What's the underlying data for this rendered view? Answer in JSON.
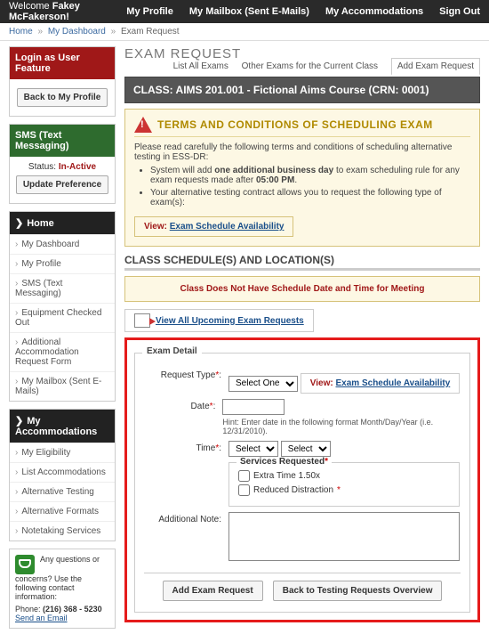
{
  "topbar": {
    "welcome_prefix": "Welcome",
    "username": "Fakey McFakerson!",
    "nav": {
      "profile": "My Profile",
      "mailbox": "My Mailbox (Sent E-Mails)",
      "accom": "My Accommodations",
      "signout": "Sign Out"
    }
  },
  "crumbs": {
    "home": "Home",
    "dash": "My Dashboard",
    "current": "Exam Request",
    "sep": "»"
  },
  "side": {
    "login": {
      "header": "Login as User Feature",
      "back_btn": "Back to My Profile"
    },
    "sms": {
      "header": "SMS (Text Messaging)",
      "status_lbl": "Status:",
      "status_val": "In-Active",
      "btn": "Update Preference"
    },
    "home": {
      "header": "Home",
      "items": [
        "My Dashboard",
        "My Profile",
        "SMS (Text Messaging)",
        "Equipment Checked Out",
        "Additional Accommodation Request Form",
        "My Mailbox (Sent E-Mails)"
      ]
    },
    "acc": {
      "header": "My Accommodations",
      "items": [
        "My Eligibility",
        "List Accommodations",
        "Alternative Testing",
        "Alternative Formats",
        "Notetaking Services"
      ]
    },
    "contact": {
      "q": "Any questions or concerns? Use the following contact information:",
      "phone_lbl": "Phone:",
      "phone": "(216) 368 - 5230",
      "email": "Send an Email"
    }
  },
  "page": {
    "title": "EXAM REQUEST",
    "tabs": {
      "all": "List All Exams",
      "other": "Other Exams for the Current Class",
      "add": "Add Exam Request"
    }
  },
  "classbar": "CLASS: AIMS 201.001 - Fictional Aims Course (CRN: 0001)",
  "warn": {
    "title": "TERMS AND CONDITIONS OF SCHEDULING EXAM",
    "intro": "Please read carefully the following terms and conditions of scheduling alternative testing in ESS-DR:",
    "b1a": "System will add ",
    "b1b": "one additional business day",
    "b1c": " to exam scheduling rule for any exam requests made after ",
    "b1d": "05:00 PM",
    "b1e": ".",
    "b2": "Your alternative testing contract allows you to request the following type of exam(s):",
    "view_lbl": "View:",
    "view_link": "Exam Schedule Availability"
  },
  "sched": {
    "title": "CLASS SCHEDULE(S) AND LOCATION(S)",
    "none": "Class Does Not Have Schedule Date and Time for Meeting",
    "upcoming": "View All Upcoming Exam Requests"
  },
  "form": {
    "legend": "Exam Detail",
    "reqtype_lbl": "Request Type",
    "select_one": "Select One",
    "view_lbl": "View:",
    "view_link": "Exam Schedule Availability",
    "date_lbl": "Date",
    "date_hint": "Hint: Enter date in the following format Month/Day/Year (i.e. 12/31/2010).",
    "time_lbl": "Time",
    "select": "Select",
    "svc_title": "Services Requested",
    "svc1": "Extra Time 1.50x",
    "svc2": "Reduced Distraction",
    "note_lbl": "Additional Note:",
    "btn_add": "Add Exam Request",
    "btn_back": "Back to Testing Requests Overview"
  }
}
